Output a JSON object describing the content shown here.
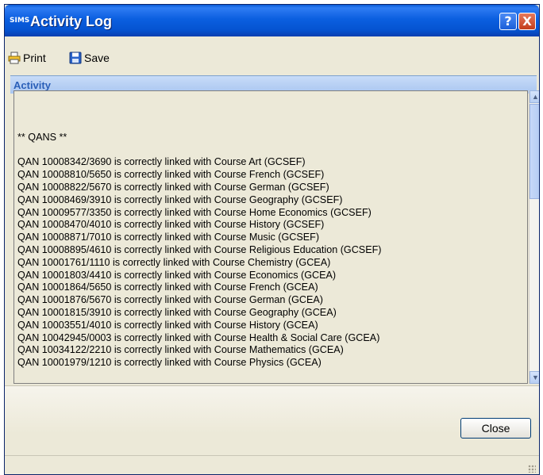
{
  "window": {
    "app_badge": "SIMS",
    "title": "Activity Log",
    "help_glyph": "?",
    "close_glyph": "X"
  },
  "toolbar": {
    "print_label": "Print",
    "save_label": "Save",
    "print_icon": "printer-icon",
    "save_icon": "floppy-disk-icon"
  },
  "section": {
    "label": "Activity"
  },
  "log": {
    "lines": [
      "",
      "** QANS **",
      "",
      "QAN 10008342/3690 is correctly linked with Course Art (GCSEF)",
      "QAN 10008810/5650 is correctly linked with Course French (GCSEF)",
      "QAN 10008822/5670 is correctly linked with Course German (GCSEF)",
      "QAN 10008469/3910 is correctly linked with Course Geography (GCSEF)",
      "QAN 10009577/3350 is correctly linked with Course Home Economics (GCSEF)",
      "QAN 10008470/4010 is correctly linked with Course History (GCSEF)",
      "QAN 10008871/7010 is correctly linked with Course Music (GCSEF)",
      "QAN 10008895/4610 is correctly linked with Course Religious Education (GCSEF)",
      "QAN 10001761/1110 is correctly linked with Course Chemistry (GCEA)",
      "QAN 10001803/4410 is correctly linked with Course Economics (GCEA)",
      "QAN 10001864/5650 is correctly linked with Course French (GCEA)",
      "QAN 10001876/5670 is correctly linked with Course German (GCEA)",
      "QAN 10001815/3910 is correctly linked with Course Geography (GCEA)",
      "QAN 10003551/4010 is correctly linked with Course History (GCEA)",
      "QAN 10042945/0003 is correctly linked with Course Health & Social Care (GCEA)",
      "QAN 10034122/2210 is correctly linked with Course Mathematics (GCEA)",
      "QAN 10001979/1210 is correctly linked with Course Physics (GCEA)"
    ]
  },
  "footer": {
    "close_label": "Close"
  },
  "colors": {
    "titlebar": "#0553d0",
    "section_header_text": "#2a5fb8",
    "window_bg": "#ece9d8"
  }
}
